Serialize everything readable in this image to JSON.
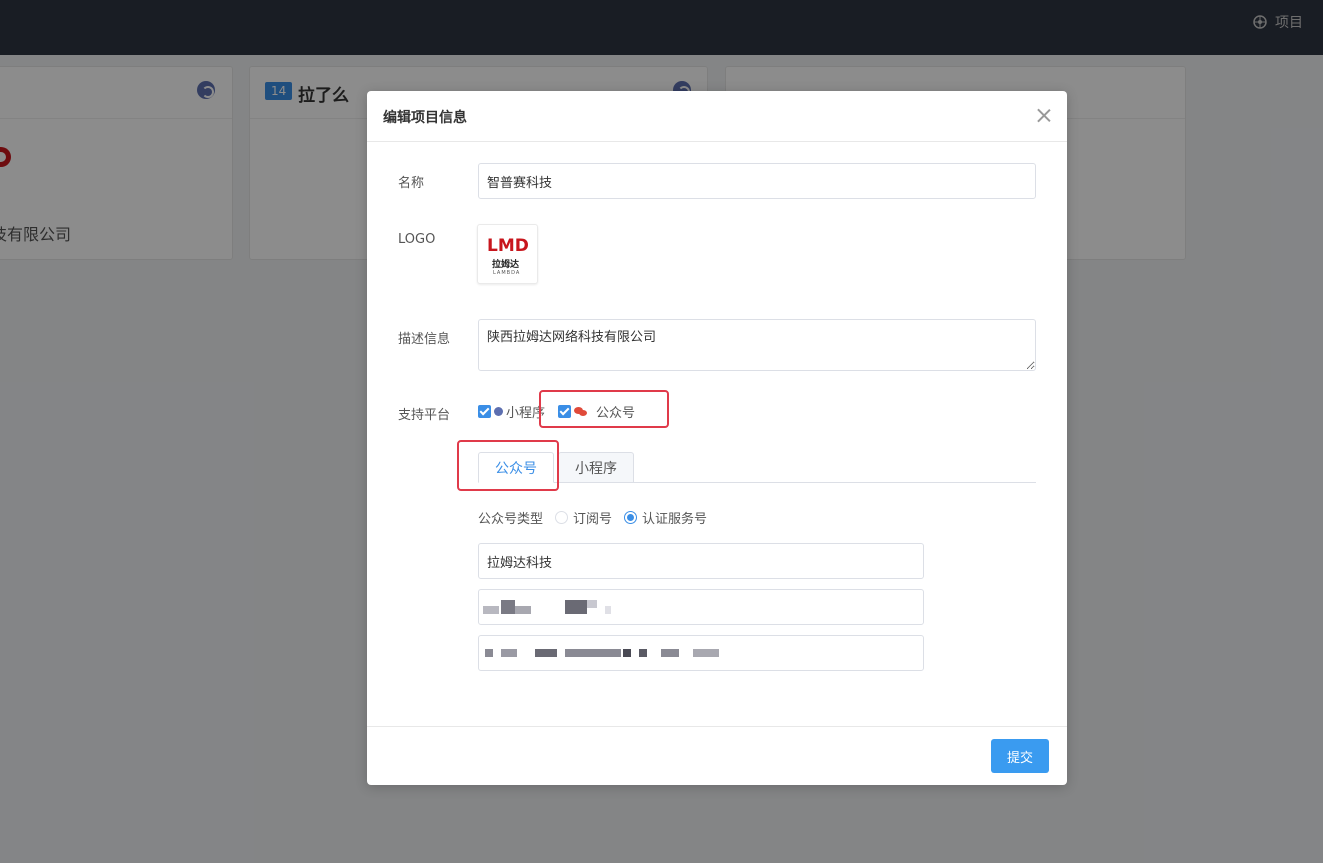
{
  "topbar": {
    "project_label": "项目"
  },
  "cards": [
    {
      "desc_partial": "技有限公司"
    },
    {
      "badge": "14",
      "name": "拉了么"
    },
    {}
  ],
  "dialog": {
    "title": "编辑项目信息",
    "form": {
      "name_label": "名称",
      "name_value": "智普赛科技",
      "logo_label": "LOGO",
      "logo": {
        "mark": "LMD",
        "cn": "拉姆达",
        "en": "LAMBDA"
      },
      "desc_label": "描述信息",
      "desc_value": "陕西拉姆达网络科技有限公司",
      "platform_label": "支持平台",
      "platforms": [
        {
          "label": "小程序",
          "checked": true,
          "icon": "mini-program-icon"
        },
        {
          "label": "公众号",
          "checked": true,
          "icon": "wechat-icon"
        }
      ]
    },
    "tabs": [
      {
        "label": "公众号",
        "active": true
      },
      {
        "label": "小程序",
        "active": false
      }
    ],
    "official_account": {
      "type_label": "公众号类型",
      "types": [
        {
          "label": "订阅号",
          "selected": false
        },
        {
          "label": "认证服务号",
          "selected": true
        }
      ],
      "name_value": "拉姆达科技"
    },
    "submit_label": "提交"
  },
  "colors": {
    "primary": "#3a8ee6",
    "highlight": "#e03a4a",
    "brand_red": "#c8161d"
  }
}
